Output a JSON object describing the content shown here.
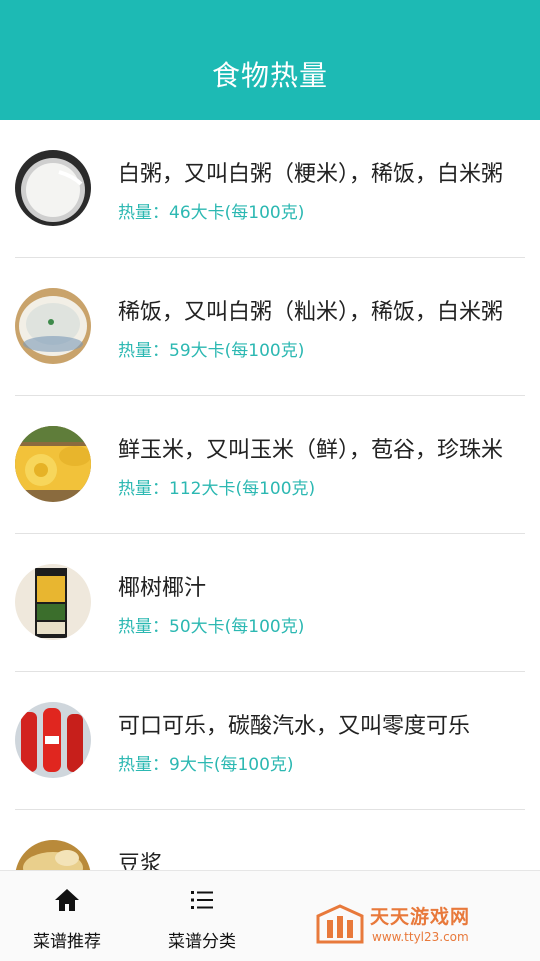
{
  "header": {
    "title": "食物热量"
  },
  "foods": [
    {
      "name": "白粥，又叫白粥（粳米），稀饭，白米粥",
      "kcal": "热量：46大卡(每100克)",
      "icon": "white-porridge-image"
    },
    {
      "name": "稀饭，又叫白粥（籼米），稀饭，白米粥",
      "kcal": "热量：59大卡(每100克)",
      "icon": "rice-congee-image"
    },
    {
      "name": "鲜玉米，又叫玉米（鲜），苞谷，珍珠米",
      "kcal": "热量：112大卡(每100克)",
      "icon": "fresh-corn-image"
    },
    {
      "name": "椰树椰汁",
      "kcal": "热量：50大卡(每100克)",
      "icon": "coconut-juice-image"
    },
    {
      "name": "可口可乐，碳酸汽水，又叫零度可乐",
      "kcal": "热量：9大卡(每100克)",
      "icon": "coca-cola-image"
    },
    {
      "name": "豆浆",
      "kcal": "",
      "icon": "soy-milk-image"
    }
  ],
  "tabbar": {
    "tabs": [
      {
        "label": "菜谱推荐",
        "icon": "home-icon"
      },
      {
        "label": "菜谱分类",
        "icon": "list-icon"
      }
    ]
  },
  "watermark": {
    "title": "天天游戏网",
    "url": "www.ttyl23.com"
  },
  "colors": {
    "header": "#1dbab4",
    "accent": "#2cb8b2",
    "watermark": "#e8793b"
  }
}
